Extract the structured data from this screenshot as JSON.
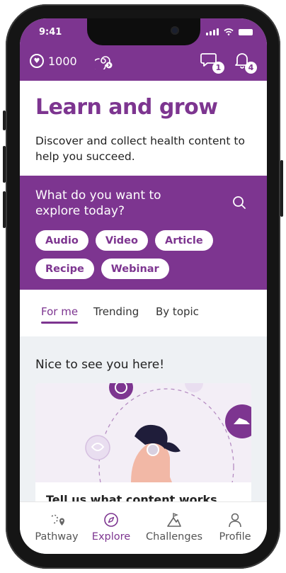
{
  "status_bar": {
    "time": "9:41"
  },
  "header": {
    "points": "1000",
    "points_icon": "coin-heart-icon",
    "streak_icon": "swirl-icon",
    "messages_icon": "chat-icon",
    "messages_count": "1",
    "notifications_icon": "bell-icon",
    "notifications_count": "4"
  },
  "hero": {
    "title": "Learn and grow",
    "subtitle": "Discover and collect health content to help you succeed."
  },
  "explore": {
    "question": "What do you want to explore today?",
    "search_icon": "search-icon",
    "chips": [
      "Audio",
      "Video",
      "Article",
      "Recipe",
      "Webinar"
    ]
  },
  "tabs": {
    "items": [
      "For me",
      "Trending",
      "By topic"
    ],
    "active": "For me"
  },
  "feed": {
    "heading": "Nice to see you here!",
    "card_title": "Tell us what content works"
  },
  "bottom_nav": {
    "items": [
      {
        "label": "Pathway",
        "icon": "pathway-icon"
      },
      {
        "label": "Explore",
        "icon": "compass-icon"
      },
      {
        "label": "Challenges",
        "icon": "mountain-flag-icon"
      },
      {
        "label": "Profile",
        "icon": "person-icon"
      }
    ],
    "active": "Explore"
  },
  "colors": {
    "brand": "#7d3590",
    "background": "#eef1f4",
    "accent_light": "#e9def0"
  }
}
